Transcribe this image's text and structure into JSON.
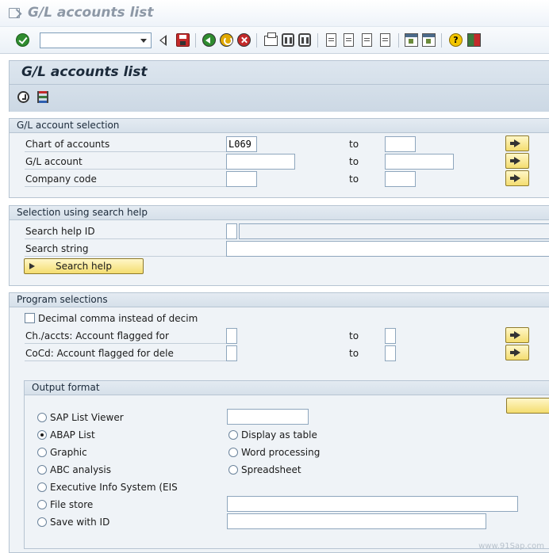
{
  "window": {
    "title": "G/L accounts list"
  },
  "toolbar": {
    "command_value": ""
  },
  "page": {
    "title": "G/L accounts list"
  },
  "gl_selection": {
    "title": "G/L account selection",
    "rows": [
      {
        "label": "Chart of accounts",
        "from": "L069",
        "to_label": "to",
        "to": ""
      },
      {
        "label": "G/L account",
        "from": "",
        "to_label": "to",
        "to": ""
      },
      {
        "label": "Company code",
        "from": "",
        "to_label": "to",
        "to": ""
      }
    ]
  },
  "search_help": {
    "title": "Selection using search help",
    "id_label": "Search help ID",
    "id_value": "",
    "id_desc": "",
    "string_label": "Search string",
    "string_value": "",
    "button_label": "Search help"
  },
  "program": {
    "title": "Program selections",
    "decimal_label": "Decimal comma instead of decim",
    "rows": [
      {
        "label": "Ch./accts: Account flagged for",
        "from": "",
        "to_label": "to",
        "to": ""
      },
      {
        "label": "CoCd: Account flagged for dele",
        "from": "",
        "to_label": "to",
        "to": ""
      }
    ]
  },
  "output": {
    "title": "Output format",
    "button_label": "",
    "alv_value": "",
    "file_value": "",
    "save_value": "",
    "options": [
      {
        "label": "SAP List Viewer",
        "selected": false
      },
      {
        "label": "ABAP List",
        "selected": true
      },
      {
        "label": "Graphic",
        "selected": false
      },
      {
        "label": "ABC analysis",
        "selected": false
      },
      {
        "label": "Executive Info System (EIS",
        "selected": false
      },
      {
        "label": "File store",
        "selected": false
      },
      {
        "label": "Save with ID",
        "selected": false
      },
      {
        "label": "Display as table",
        "selected": false
      },
      {
        "label": "Word processing",
        "selected": false
      },
      {
        "label": "Spreadsheet",
        "selected": false
      }
    ]
  },
  "watermark": "www.91Sap.com"
}
